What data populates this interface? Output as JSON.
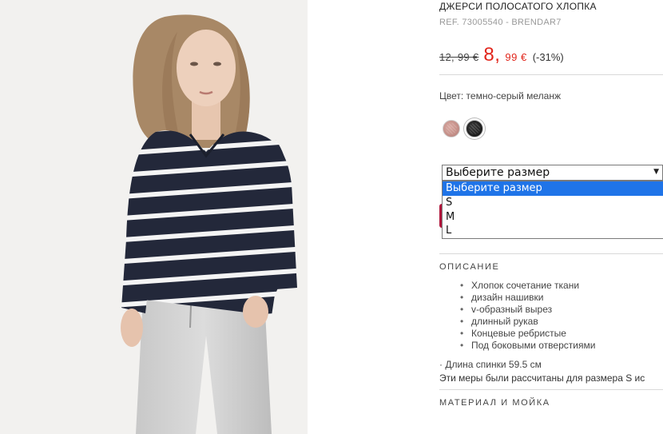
{
  "product": {
    "title": "ДЖЕРСИ ПОЛОСАТОГО ХЛОПКА",
    "ref": "REF. 73005540 - BRENDAR7",
    "old_price": "12, 99 €",
    "new_price_int": "8,",
    "new_price_dec": "99 €",
    "discount": "(-31%)",
    "color_label": "Цвет: темно-серый меланж"
  },
  "colors": {
    "accent_price": "#e1251b",
    "swatches": [
      "pink-melange",
      "dark-grey-melange"
    ]
  },
  "size_select": {
    "value": "Выберите размер",
    "options": [
      "Выберите размер",
      "S",
      "M",
      "L"
    ],
    "highlighted": "Выберите размер"
  },
  "description": {
    "heading": "ОПИСАНИЕ",
    "bullets": [
      "Хлопок сочетание ткани",
      "дизайн нашивки",
      "v-образный вырез",
      "длинный рукав",
      "Концевые ребристые",
      "Под боковыми отверстиями"
    ],
    "length": "· Длина спинки 59.5 см",
    "measurement_note": "Эти меры были рассчитаны для размера S ис"
  },
  "material": {
    "heading": "МАТЕРИАЛ И МОЙКА"
  }
}
